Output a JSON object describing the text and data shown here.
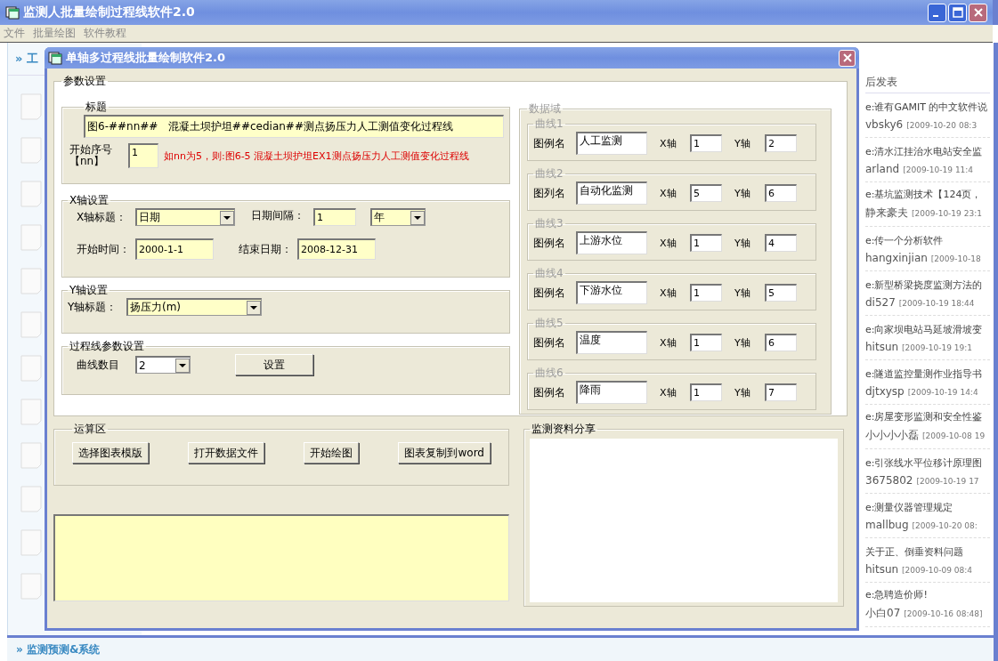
{
  "main_window": {
    "title": "监测人批量绘制过程线软件2.0"
  },
  "menu": [
    {
      "label": "文件",
      "disabled": true
    },
    {
      "label": "批量绘图",
      "disabled": true
    },
    {
      "label": "软件教程",
      "disabled": true
    }
  ],
  "background_page": {
    "left_header": "» 工",
    "posts_header": "后发表",
    "posts": [
      {
        "title": "e:谁有GAMIT 的中文软件说",
        "author": "vbsky6",
        "time": "[2009-10-20 08:3"
      },
      {
        "title": "e:清水江挂治水电站安全监",
        "author": "arland",
        "time": "[2009-10-19 11:4"
      },
      {
        "title": "e:基坑监测技术【124页，",
        "author": "静来豪夫",
        "time": "[2009-10-19 23:1"
      },
      {
        "title": "e:传一个分析软件",
        "author": "hangxinjian",
        "time": "[2009-10-18"
      },
      {
        "title": "e:新型桥梁挠度监测方法的",
        "author": "di527",
        "time": "[2009-10-19 18:44"
      },
      {
        "title": "e:向家坝电站马延坡滑坡变",
        "author": "hitsun",
        "time": "[2009-10-19 19:1"
      },
      {
        "title": "e:隧道监控量测作业指导书",
        "author": "djtxysp",
        "time": "[2009-10-19 14:4"
      },
      {
        "title": "e:房屋变形监测和安全性鉴",
        "author": "小小小小磊",
        "time": "[2009-10-08 19"
      },
      {
        "title": "e:引张线水平位移计原理图",
        "author": "3675802",
        "time": "[2009-10-19 17"
      },
      {
        "title": "e:测量仪器管理规定",
        "author": "mallbug",
        "time": "[2009-10-20 08:"
      },
      {
        "title": "关于正、倒垂资料问题",
        "author": "hitsun",
        "time": "[2009-10-09 08:4"
      },
      {
        "title": "e:急聘造价师!",
        "author": "小白07",
        "time": "[2009-10-16 08:48]"
      }
    ],
    "bottom_header": "» 监测预测&系统"
  },
  "dialog": {
    "title": "单轴多过程线批量绘制软件2.0",
    "params_legend": "参数设置",
    "title_group": {
      "legend": "标题",
      "value": "图6-##nn##   混凝土坝护坦##cedian##测点扬压力人工测值变化过程线",
      "seq_label": "开始序号",
      "seq_sub": "【nn】",
      "seq_value": "1",
      "hint": "如nn为5，则:图6-5    混凝土坝护坦EX1测点扬压力人工测值变化过程线"
    },
    "x_axis": {
      "legend": "X轴设置",
      "title_label": "X轴标题：",
      "title_value": "日期",
      "interval_label": "日期间隔：",
      "interval_value": "1",
      "unit_value": "年",
      "start_label": "开始时间：",
      "start_value": "2000-1-1",
      "end_label": "结束日期：",
      "end_value": "2008-12-31"
    },
    "y_axis": {
      "legend": "Y轴设置",
      "title_label": "Y轴标题：",
      "title_value": "扬压力(m)"
    },
    "curve_params": {
      "legend": "过程线参数设置",
      "count_label": "曲线数目",
      "count_value": "2",
      "button": "设置"
    },
    "data_area": {
      "legend": "数据域",
      "curves": [
        {
          "legend": "曲线1",
          "name_label": "图例名",
          "name_value": "人工监测",
          "x_label": "X轴",
          "x_value": "1",
          "y_label": "Y轴",
          "y_value": "2"
        },
        {
          "legend": "曲线2",
          "name_label": "图列名",
          "name_value": "自动化监测",
          "x_label": "X轴",
          "x_value": "5",
          "y_label": "Y轴",
          "y_value": "6"
        },
        {
          "legend": "曲线3",
          "name_label": "图例名",
          "name_value": "上游水位",
          "x_label": "X轴",
          "x_value": "1",
          "y_label": "Y轴",
          "y_value": "4"
        },
        {
          "legend": "曲线4",
          "name_label": "图例名",
          "name_value": "下游水位",
          "x_label": "X轴",
          "x_value": "1",
          "y_label": "Y轴",
          "y_value": "5"
        },
        {
          "legend": "曲线5",
          "name_label": "图例名",
          "name_value": "温度",
          "x_label": "X轴",
          "x_value": "1",
          "y_label": "Y轴",
          "y_value": "6"
        },
        {
          "legend": "曲线6",
          "name_label": "图例名",
          "name_value": "降雨",
          "x_label": "X轴",
          "x_value": "1",
          "y_label": "Y轴",
          "y_value": "7"
        }
      ]
    },
    "ops": {
      "legend": "运算区",
      "buttons": [
        "选择图表模版",
        "打开数据文件",
        "开始绘图",
        "图表复制到word"
      ]
    },
    "share": {
      "legend": "监测资料分享"
    }
  }
}
